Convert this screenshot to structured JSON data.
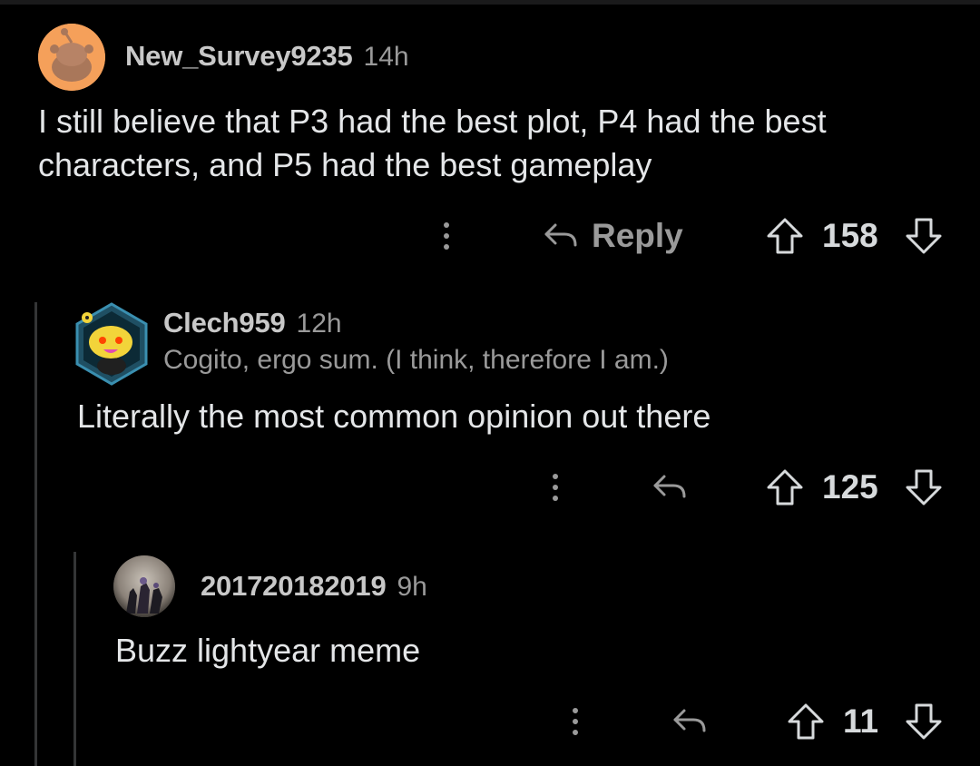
{
  "comments": [
    {
      "username": "New_Survey9235",
      "time": "14h",
      "flair": "",
      "body": "I still believe that P3 had the best plot, P4 had the best characters, and P5 had the best gameplay",
      "reply_label": "Reply",
      "score": "158",
      "avatar_color": "#f5a05a"
    },
    {
      "username": "Clech959",
      "time": "12h",
      "flair": "Cogito, ergo sum. (I think, therefore I am.)",
      "body": "Literally the most common opinion out there",
      "reply_label": "",
      "score": "125",
      "avatar_color": "#1f6f8b"
    },
    {
      "username": "201720182019",
      "time": "9h",
      "flair": "",
      "body": "Buzz lightyear meme",
      "reply_label": "",
      "score": "11",
      "avatar_color": "#5a5550"
    }
  ],
  "icons": {
    "more": "vertical-dots-icon",
    "reply": "reply-arrow-icon",
    "upvote": "upvote-arrow-icon",
    "downvote": "downvote-arrow-icon"
  },
  "colors": {
    "background": "#000000",
    "text_primary": "#e4e6e8",
    "text_secondary": "#9a9a9a",
    "thread_line": "#343536"
  }
}
